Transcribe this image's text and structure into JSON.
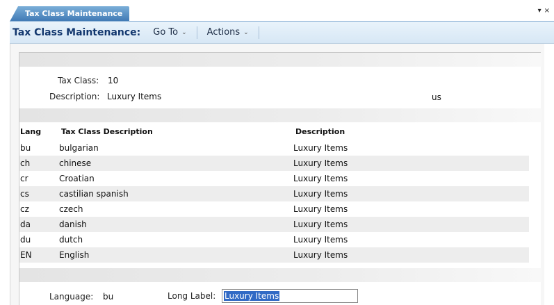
{
  "tab": {
    "label": "Tax Class Maintenance"
  },
  "window_controls": {
    "menu": "▾",
    "close": "×"
  },
  "toolbar": {
    "title": "Tax Class Maintenance:",
    "menus": [
      {
        "label": "Go To"
      },
      {
        "label": "Actions"
      }
    ]
  },
  "header": {
    "tax_class_label": "Tax Class:",
    "tax_class_value": "10",
    "description_label": "Description:",
    "description_value": "Luxury Items",
    "language_code": "us"
  },
  "table": {
    "columns": [
      "Lang",
      "Tax Class Description",
      "Description"
    ],
    "rows": [
      {
        "lang": "bu",
        "tax_class_description": "bulgarian",
        "description": "Luxury Items"
      },
      {
        "lang": "ch",
        "tax_class_description": "chinese",
        "description": "Luxury Items"
      },
      {
        "lang": "cr",
        "tax_class_description": "Croatian",
        "description": "Luxury Items"
      },
      {
        "lang": "cs",
        "tax_class_description": "castilian spanish",
        "description": "Luxury Items"
      },
      {
        "lang": "cz",
        "tax_class_description": "czech",
        "description": "Luxury Items"
      },
      {
        "lang": "da",
        "tax_class_description": "danish",
        "description": "Luxury Items"
      },
      {
        "lang": "du",
        "tax_class_description": "dutch",
        "description": "Luxury Items"
      },
      {
        "lang": "EN",
        "tax_class_description": "English",
        "description": "Luxury Items"
      }
    ]
  },
  "detail": {
    "language_label": "Language:",
    "language_value": "bu",
    "long_label_label": "Long Label:",
    "long_label_value": "Luxury Items"
  }
}
